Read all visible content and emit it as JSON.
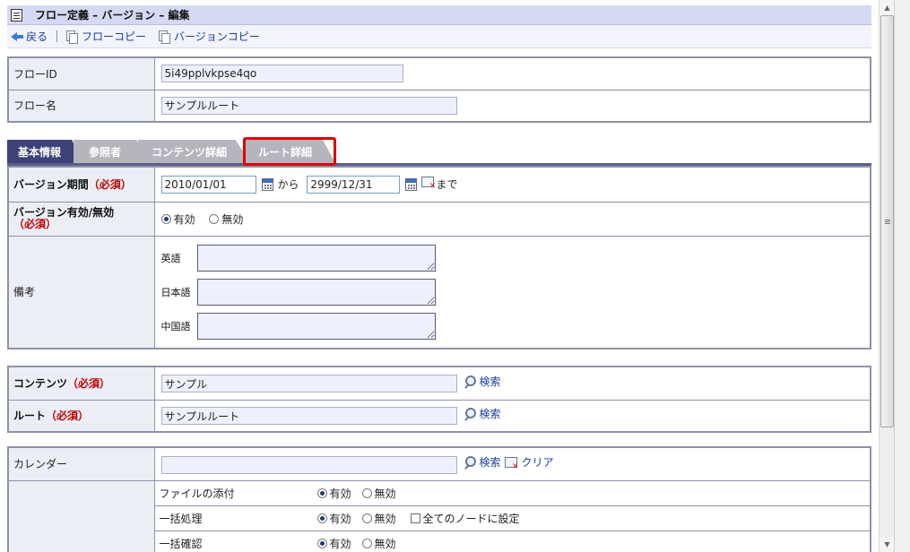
{
  "title": "フロー定義 – バージョン – 編集",
  "toolbar": {
    "back": "戻る",
    "flow_copy": "フローコピー",
    "version_copy": "バージョンコピー"
  },
  "flow": {
    "id_label": "フローID",
    "id_value": "5i49pplvkpse4qo",
    "name_label": "フロー名",
    "name_value": "サンプルルート"
  },
  "tabs": [
    {
      "label": "基本情報",
      "active": true
    },
    {
      "label": "参照者",
      "active": false
    },
    {
      "label": "コンテンツ詳細",
      "active": false
    },
    {
      "label": "ルート詳細",
      "active": false,
      "highlighted": true
    }
  ],
  "version": {
    "period_label": "バージョン期間",
    "required": "（必須）",
    "start": "2010/01/01",
    "from": "から",
    "end": "2999/12/31",
    "until": "まで",
    "enabled_label": "バージョン有効/無効",
    "enabled_required": "（必須）",
    "enabled": "有効",
    "disabled": "無効"
  },
  "remarks": {
    "label": "備考",
    "english": "英語",
    "japanese": "日本語",
    "chinese": "中国語"
  },
  "content": {
    "label": "コンテンツ",
    "required": "（必須）",
    "value": "サンプル",
    "search": "検索"
  },
  "route": {
    "label": "ルート",
    "required": "（必須）",
    "value": "サンプルルート",
    "search": "検索"
  },
  "calendar": {
    "label": "カレンダー",
    "value": "",
    "search": "検索",
    "clear": "クリア"
  },
  "options": {
    "file_attach": "ファイルの添付",
    "bulk_process": "一括処理",
    "bulk_confirm": "一括確認",
    "enabled": "有効",
    "disabled": "無効",
    "all_nodes": "全てのノードに設定"
  }
}
